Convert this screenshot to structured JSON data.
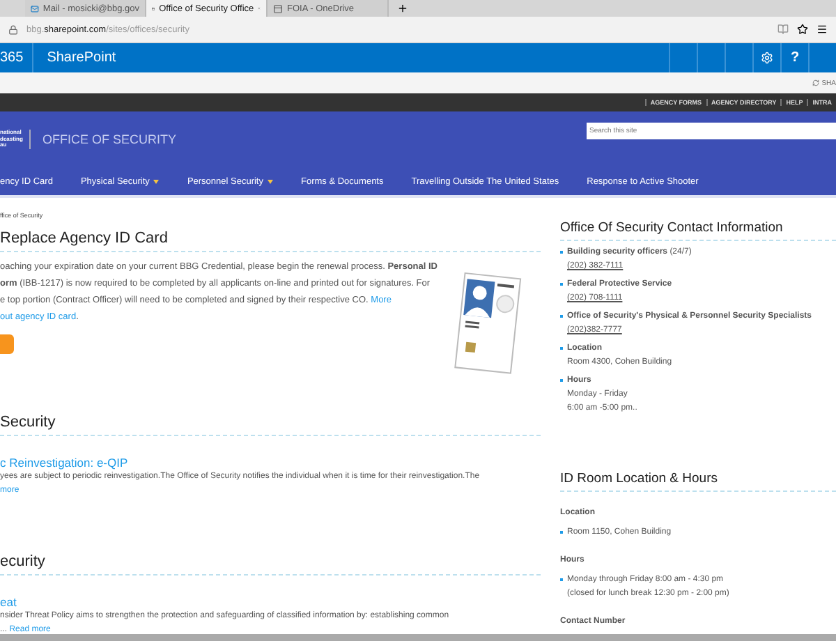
{
  "browser": {
    "tabs": [
      {
        "title": "Mail - mosicki@bbg.gov",
        "kind": "mail",
        "selected": false
      },
      {
        "title": "Office of Security Office",
        "kind": "page",
        "selected": true
      },
      {
        "title": "FOIA - OneDrive",
        "kind": "page",
        "selected": false
      }
    ],
    "url": {
      "sub": "bbg.",
      "domain": "sharepoint.com",
      "path": "/sites/offices/security"
    }
  },
  "suite_bar": {
    "product": "365",
    "app": "SharePoint",
    "help": "?"
  },
  "share": "SHA",
  "top_links": [
    "AGENCY FORMS",
    "AGENCY DIRECTORY",
    "HELP",
    "INTRA"
  ],
  "header": {
    "logo_lines": [
      "national",
      "dcasting",
      "au"
    ],
    "site_title": "OFFICE OF SECURITY",
    "search_placeholder": "Search this site"
  },
  "nav": [
    {
      "label": "ency ID Card",
      "has_menu": false
    },
    {
      "label": "Physical Security",
      "has_menu": true
    },
    {
      "label": "Personnel Security",
      "has_menu": true
    },
    {
      "label": "Forms & Documents",
      "has_menu": false
    },
    {
      "label": "Travelling Outside The United States",
      "has_menu": false
    },
    {
      "label": "Response to Active Shooter",
      "has_menu": false
    }
  ],
  "breadcrumb": "ffice of Security",
  "id_card_section": {
    "heading": "Replace Agency ID Card",
    "lines": [
      [
        {
          "kind": "plain",
          "text": "oaching your expiration date on your current BBG Credential, please begin the renewal process. "
        },
        {
          "kind": "bold",
          "text": "Personal ID"
        }
      ],
      [
        {
          "kind": "bold",
          "text": "orm"
        },
        {
          "kind": "plain",
          "text": " (IBB-1217) is now required to be completed by all applicants on-line and printed out for signatures. For"
        }
      ],
      [
        {
          "kind": "plain",
          "text": "e top portion (Contract Officer) will need to be completed and signed by their respective CO. "
        },
        {
          "kind": "link",
          "text": "More"
        }
      ],
      [
        {
          "kind": "link",
          "text": "out agency ID card"
        },
        {
          "kind": "plain",
          "text": "."
        }
      ]
    ]
  },
  "sections": [
    {
      "heading": "Security",
      "title": "c Reinvestigation: e-QIP",
      "lines": [
        "yees are subject to periodic reinvestigation.The Office of Security notifies the individual when it is time for their reinvestigation.The"
      ],
      "more": "more"
    },
    {
      "heading": "ecurity",
      "title": "eat",
      "lines": [
        "nsider Threat Policy aims to strengthen the protection and safeguarding of classified information by: establishing common"
      ],
      "tail": "...",
      "more": "Read more"
    }
  ],
  "contact": {
    "title": "Office Of Security Contact Information",
    "items": [
      {
        "label": "Building security officers",
        "note": "(24/7)",
        "phone": "(202) 382-7111"
      },
      {
        "label": "Federal Protective Service",
        "phone": "(202) 708-1111"
      },
      {
        "label": "Office of Security's Physical & Personnel Security Specialists",
        "phone": "(202)382-7777"
      },
      {
        "label": "Location",
        "lines": [
          "Room 4300, Cohen Building"
        ]
      },
      {
        "label": "Hours",
        "lines": [
          "Monday - Friday",
          "6:00 am -5:00 pm.."
        ]
      }
    ]
  },
  "id_room": {
    "title": "ID Room Location & Hours",
    "groups": [
      {
        "heading": "Location",
        "items": [
          [
            "Room 1150, Cohen Building"
          ]
        ]
      },
      {
        "heading": "Hours",
        "items": [
          [
            "Monday through Friday 8:00 am - 4:30 pm",
            "(closed for lunch break 12:30 pm - 2:00 pm)"
          ]
        ]
      },
      {
        "heading": "Contact Number"
      }
    ]
  }
}
